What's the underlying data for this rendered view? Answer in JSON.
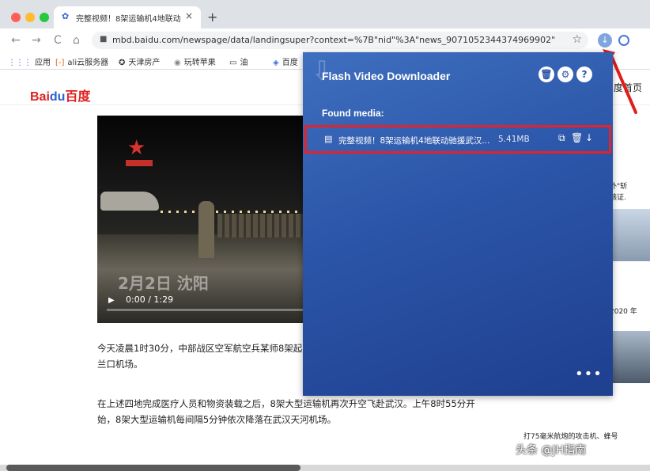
{
  "browser": {
    "tab_title": "完整视频！8架运输机4地联动驰",
    "tab_close": "×",
    "new_tab": "+",
    "url": "mbd.baidu.com/newspage/data/landingsuper?context=%7B\"nid\"%3A\"news_9071052344374969902\"%7D&n...",
    "back": "←",
    "forward": "→",
    "reload": "C",
    "home": "⌂",
    "star": "☆",
    "lock": "🔒",
    "ext_arrow": "↓"
  },
  "bookmarks": [
    {
      "icon": "⋮⋮⋮",
      "label": "应用"
    },
    {
      "icon": "[-]",
      "label": "ali云服务器"
    },
    {
      "icon": "✪",
      "label": "天津房产"
    },
    {
      "icon": "◉",
      "label": "玩转苹果"
    },
    {
      "icon": "▭",
      "label": "油"
    },
    {
      "icon": "◈",
      "label": "百度"
    }
  ],
  "page": {
    "logo_a": "Bai",
    "logo_paw": "du",
    "logo_b": "百度",
    "right_header": "度首页",
    "video_date": "2月2日 沈阳",
    "video_time": "0:00 / 1:29",
    "video_play": "▶",
    "para1": "今天凌晨1时30分，中部战区空军航空兵某师8架起飞，凌晨4点开始分别抵达沈阳桃仙机场、兰口机场。",
    "para2": "在上述四地完成医疗人员和物资装载之后，8架大型运输机再次升空飞赴武汉。上午8时55分开始，8架大型运输机每间隔5分钟依次降落在武汉天河机场。",
    "side1": "里外\"斩",
    "side2": "残骸证.",
    "side3": "卑2020 年",
    "bottom_caption": "打75毫米航炮的攻击机、蜂号",
    "watermark": "头条 @JH指南"
  },
  "popup": {
    "title": "Flash Video Downloader",
    "found_label": "Found media:",
    "media_name": "完整视频！8架运输机4地联动驰援武汉...",
    "media_size": "5.41MB",
    "more": "•••",
    "btn_trash": "🗑",
    "btn_settings": "⚙",
    "btn_help": "?",
    "act_copy": "⧉",
    "act_delete": "🗑",
    "act_download": "↓",
    "file_icon": "▤"
  }
}
